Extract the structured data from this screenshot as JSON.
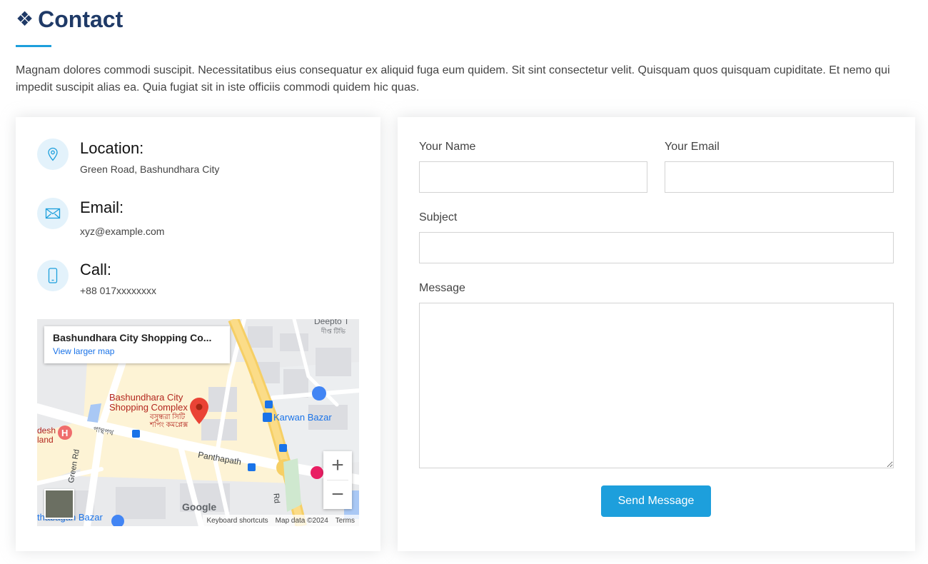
{
  "section": {
    "title": "Contact",
    "intro": "Magnam dolores commodi suscipit. Necessitatibus eius consequatur ex aliquid fuga eum quidem. Sit sint consectetur velit. Quisquam quos quisquam cupiditate. Et nemo qui impedit suscipit alias ea. Quia fugiat sit in iste officiis commodi quidem hic quas."
  },
  "info": {
    "location": {
      "title": "Location:",
      "text": "Green Road, Bashundhara City",
      "icon": "map-pin-icon"
    },
    "email": {
      "title": "Email:",
      "text": "xyz@example.com",
      "icon": "envelope-icon"
    },
    "call": {
      "title": "Call:",
      "text": "+88 017xxxxxxxx",
      "icon": "phone-icon"
    }
  },
  "map": {
    "place_name": "Bashundhara City Shopping Co...",
    "view_larger": "View larger map",
    "labels": {
      "marker_line1": "Bashundhara City",
      "marker_line2": "Shopping Complex",
      "marker_bn1": "বসুন্ধরা সিটি",
      "marker_bn2": "শপিং কমপ্লেক্স",
      "karwan_bazar": "Karwan Bazar",
      "panthapath": "Panthapath",
      "panthapath_bn": "পান্থপথ",
      "green_rd": "Green Rd",
      "rd": "Rd",
      "deepto": "Deepto T",
      "deepto_bn": "দীপ্ত টিভি",
      "desh": "desh",
      "hand": "land",
      "thabagan": "thabagan Bazar"
    },
    "zoom_in": "+",
    "zoom_out": "−",
    "google": "Google",
    "keyboard_shortcuts": "Keyboard shortcuts",
    "map_data": "Map data ©2024",
    "terms": "Terms"
  },
  "form": {
    "name_label": "Your Name",
    "email_label": "Your Email",
    "subject_label": "Subject",
    "message_label": "Message",
    "name_value": "",
    "email_value": "",
    "subject_value": "",
    "message_value": "",
    "submit_label": "Send Message"
  },
  "colors": {
    "accent": "#1d9fdc",
    "title": "#1f3a67",
    "icon_bg": "#e3f2fb"
  }
}
